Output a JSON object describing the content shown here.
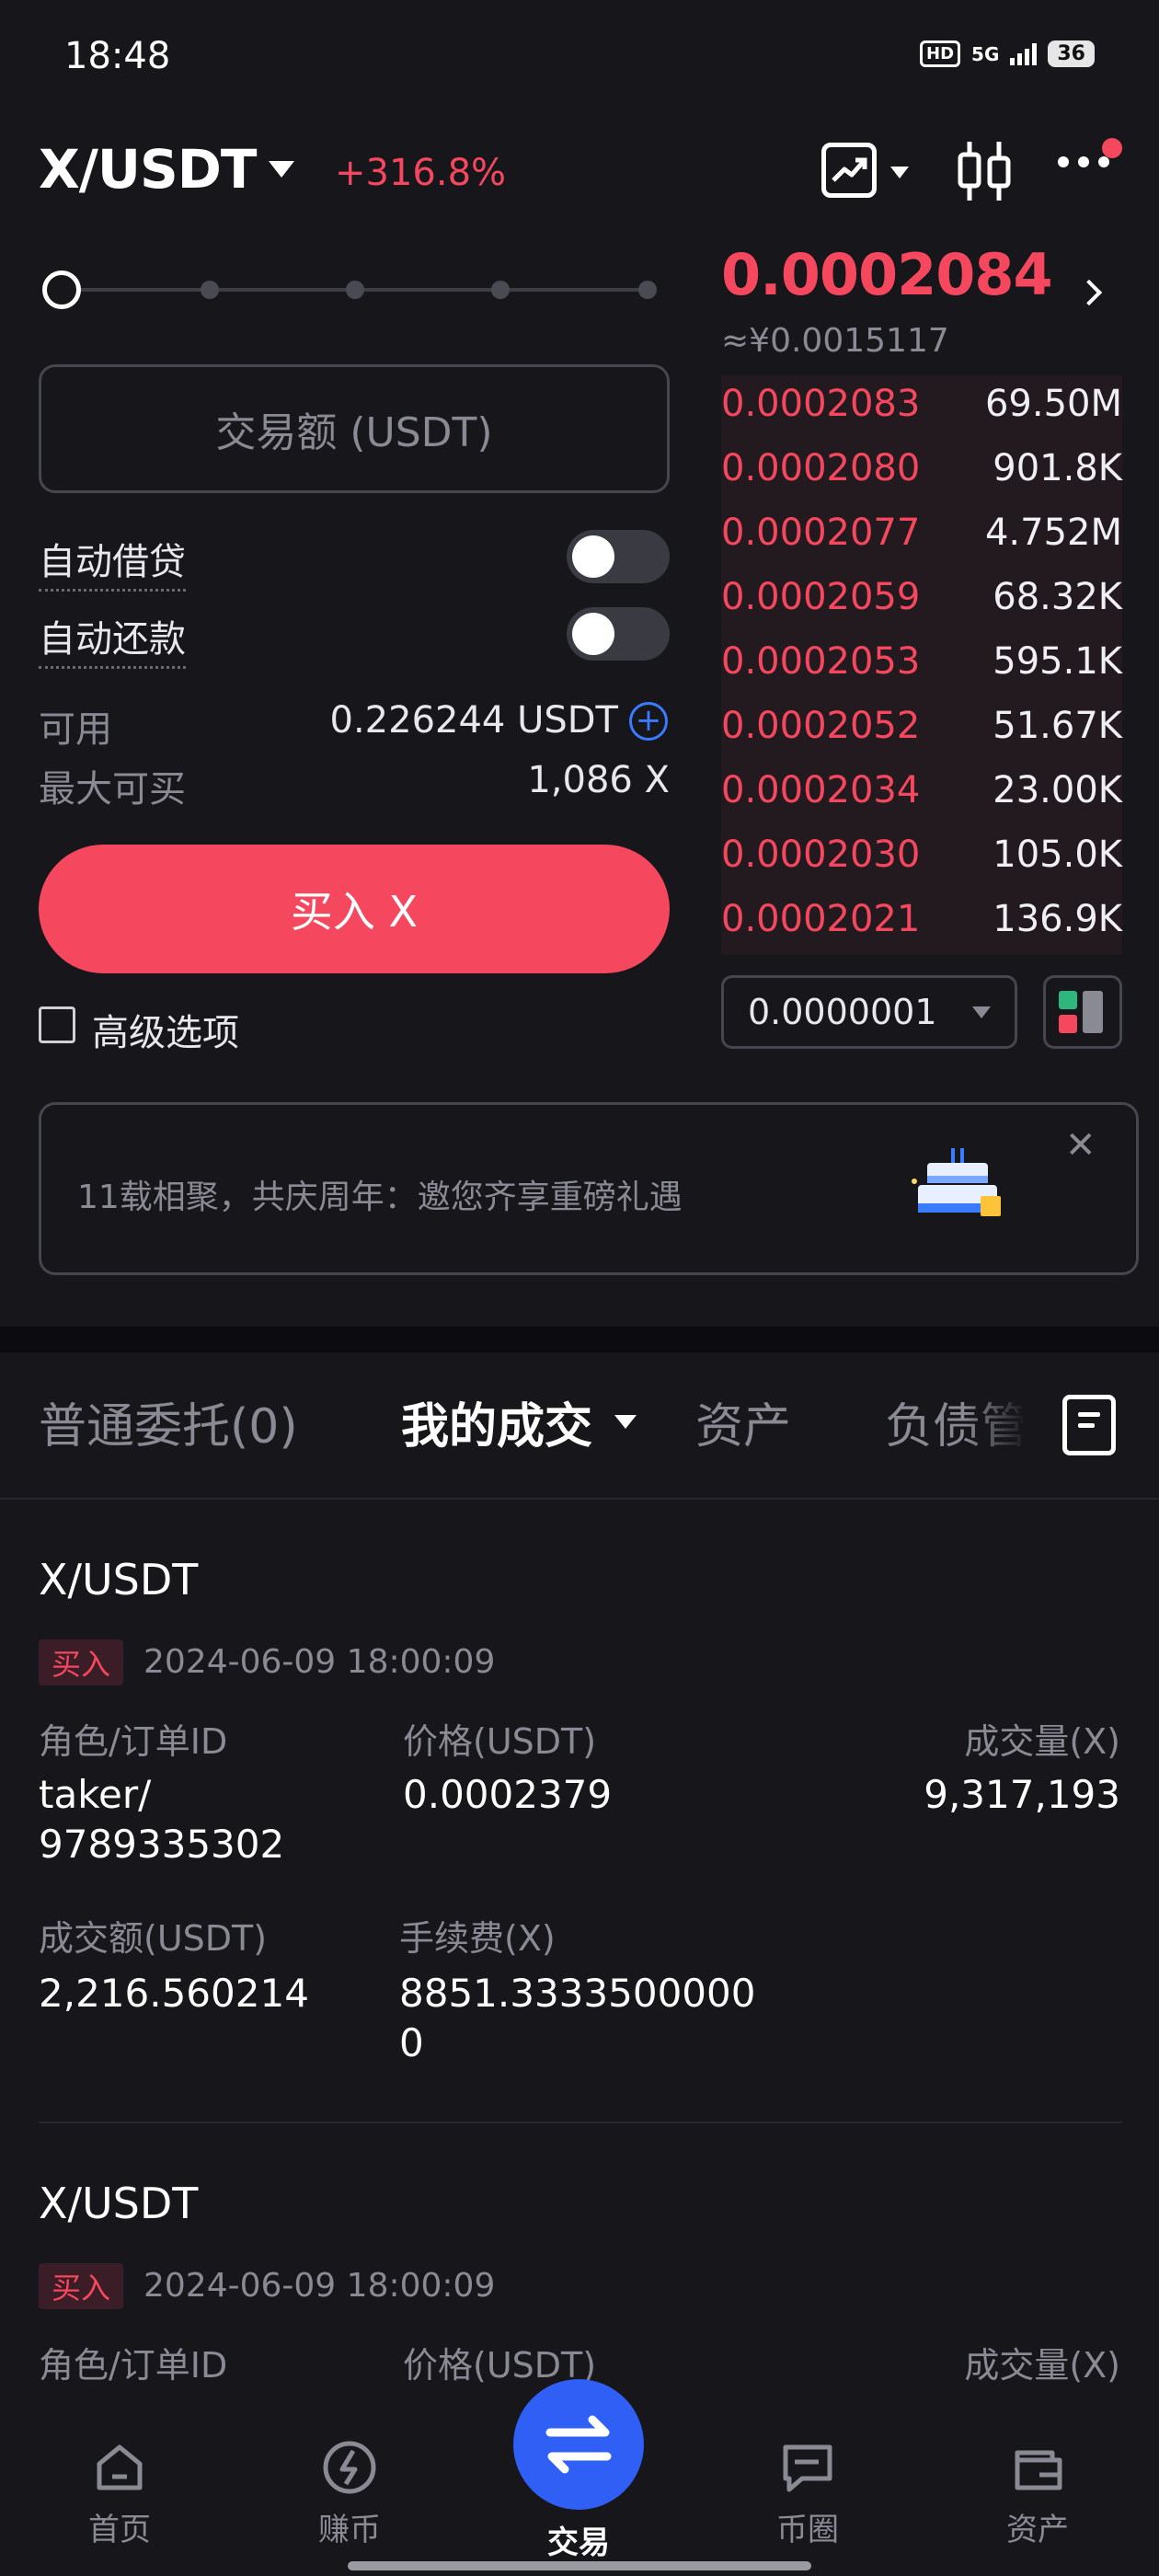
{
  "status_bar": {
    "time": "18:48",
    "hd": "HD",
    "network": "5G",
    "battery": "36"
  },
  "header": {
    "pair": "X/USDT",
    "change": "+316.8%"
  },
  "trade_form": {
    "amount_placeholder": "交易额 (USDT)",
    "auto_borrow_label": "自动借贷",
    "auto_repay_label": "自动还款",
    "auto_borrow_on": false,
    "auto_repay_on": false,
    "available_label": "可用",
    "available_value": "0.226244 USDT",
    "max_buy_label": "最大可买",
    "max_buy_value": "1,086 X",
    "buy_button": "买入 X",
    "advanced_label": "高级选项",
    "slider_percent": 0
  },
  "order_book": {
    "last_price": "0.0002084",
    "last_price_cny": "≈¥0.0015117",
    "asks": [
      {
        "price": "0.0002083",
        "qty": "69.50M"
      },
      {
        "price": "0.0002080",
        "qty": "901.8K"
      },
      {
        "price": "0.0002077",
        "qty": "4.752M"
      },
      {
        "price": "0.0002059",
        "qty": "68.32K"
      },
      {
        "price": "0.0002053",
        "qty": "595.1K"
      },
      {
        "price": "0.0002052",
        "qty": "51.67K"
      },
      {
        "price": "0.0002034",
        "qty": "23.00K"
      },
      {
        "price": "0.0002030",
        "qty": "105.0K"
      },
      {
        "price": "0.0002021",
        "qty": "136.9K"
      }
    ],
    "precision": "0.0000001"
  },
  "banner": {
    "text": "11载相聚，共庆周年：邀您齐享重磅礼遇",
    "close": "✕"
  },
  "tabs": {
    "open_orders": "普通委托(0)",
    "my_trades": "我的成交",
    "assets": "资产",
    "liabilities": "负债管"
  },
  "trades": [
    {
      "pair": "X/USDT",
      "side": "买入",
      "time": "2024-06-09 18:00:09",
      "role_label": "角色/订单ID",
      "role_value_1": "taker/",
      "role_value_2": "9789335302",
      "price_label": "价格(USDT)",
      "price_value": "0.0002379",
      "volume_label": "成交量(X)",
      "volume_value": "9,317,193",
      "amount_label": "成交额(USDT)",
      "amount_value": "2,216.560214",
      "fee_label": "手续费(X)",
      "fee_value_1": "8851.3333500000",
      "fee_value_2": "0"
    },
    {
      "pair": "X/USDT",
      "side": "买入",
      "time": "2024-06-09 18:00:09",
      "role_label": "角色/订单ID",
      "price_label": "价格(USDT)",
      "volume_label": "成交量(X)"
    }
  ],
  "bottom_nav": {
    "home": "首页",
    "earn": "赚币",
    "trade": "交易",
    "community": "币圈",
    "assets": "资产"
  }
}
